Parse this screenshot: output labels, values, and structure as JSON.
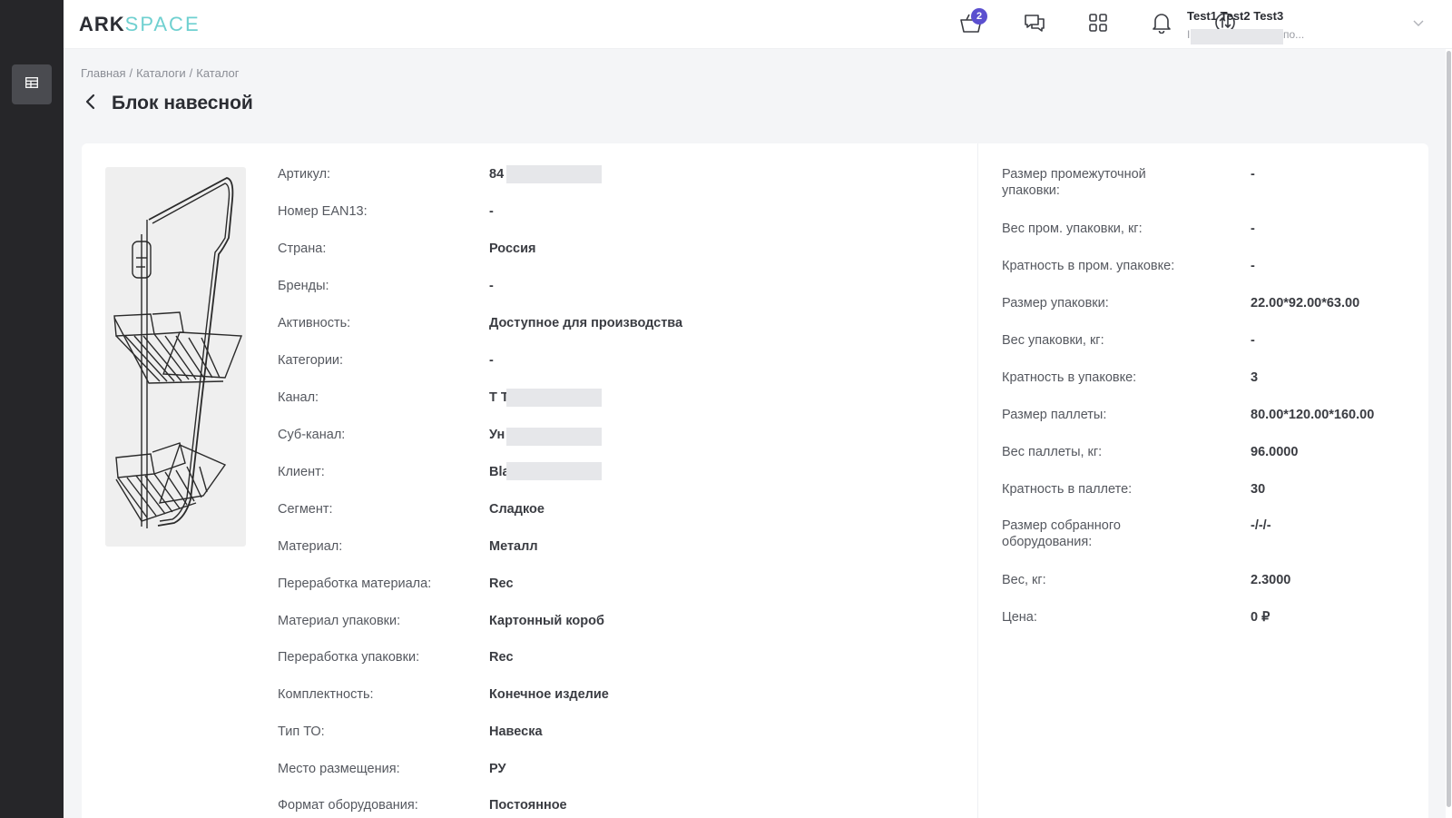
{
  "logo": {
    "ark": "ARK",
    "space": "SPACE"
  },
  "header": {
    "cart_count": "2",
    "user_name": "Test1 Test2 Test3",
    "user_sub_prefix": "I",
    "user_sub_suffix": "по..."
  },
  "breadcrumb": {
    "items": [
      "Главная",
      "Каталоги",
      "Каталог"
    ],
    "sep": "/"
  },
  "page_title": "Блок навесной",
  "left_props": [
    {
      "label": "Артикул:",
      "value": "84"
    },
    {
      "label": "Номер EAN13:",
      "value": "-"
    },
    {
      "label": "Страна:",
      "value": "Россия"
    },
    {
      "label": "Бренды:",
      "value": "-"
    },
    {
      "label": "Активность:",
      "value": "Доступное для производства"
    },
    {
      "label": "Категории:",
      "value": "-"
    },
    {
      "label": "Канал:",
      "value": "Т Т"
    },
    {
      "label": "Суб-канал:",
      "value": "Ун"
    },
    {
      "label": "Клиент:",
      "value": "Bla"
    },
    {
      "label": "Сегмент:",
      "value": "Сладкое"
    },
    {
      "label": "Материал:",
      "value": "Металл"
    },
    {
      "label": "Переработка материала:",
      "value": "Rec"
    },
    {
      "label": "Материал упаковки:",
      "value": "Картонный короб"
    },
    {
      "label": "Переработка упаковки:",
      "value": "Rec"
    },
    {
      "label": "Комплектность:",
      "value": "Конечное изделие"
    },
    {
      "label": "Тип ТО:",
      "value": "Навеска"
    },
    {
      "label": "Место размещения:",
      "value": "РУ"
    },
    {
      "label": "Формат оборудования:",
      "value": "Постоянное"
    }
  ],
  "right_props": [
    {
      "label_1": "Размер промежуточной",
      "label_2": "упаковки:",
      "value": "-"
    },
    {
      "label_1": "Вес пром. упаковки, кг:",
      "value": "-"
    },
    {
      "label_1": "Кратность в пром. упаковке:",
      "value": "-"
    },
    {
      "label_1": "Размер упаковки:",
      "value": "22.00*92.00*63.00"
    },
    {
      "label_1": "Вес упаковки, кг:",
      "value": "-"
    },
    {
      "label_1": "Кратность в упаковке:",
      "value": "3"
    },
    {
      "label_1": "Размер паллеты:",
      "value": "80.00*120.00*160.00"
    },
    {
      "label_1": "Вес паллеты, кг:",
      "value": "96.0000"
    },
    {
      "label_1": "Кратность в паллете:",
      "value": "30"
    },
    {
      "label_1": "Размер собранного",
      "label_2": "оборудования:",
      "value": "-/-/-"
    },
    {
      "label_1": "Вес, кг:",
      "value": "2.3000"
    },
    {
      "label_1": "Цена:",
      "value": "0 ₽"
    }
  ],
  "icons": {
    "sidebar": "catalog-table-icon",
    "cart": "basket-icon",
    "chat": "chat-icon",
    "apps": "grid-icon",
    "notifications": "bell-icon",
    "exchange": "exchange-icon",
    "back": "chevron-left-icon",
    "user_menu": "chevron-down-icon"
  },
  "colors": {
    "sidebar": "#262629",
    "accent": "#5b4fcf",
    "logo_space": "#6fd0d0"
  }
}
